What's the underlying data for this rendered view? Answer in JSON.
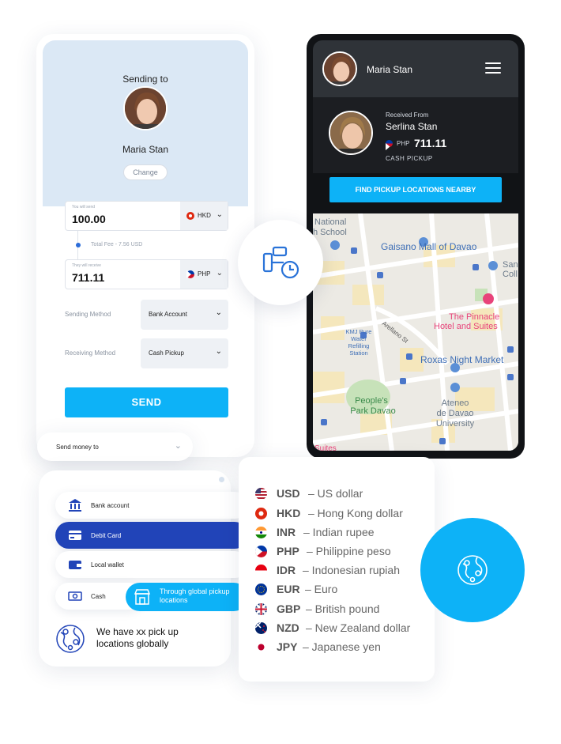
{
  "send_card": {
    "sending_to_label": "Sending to",
    "recipient_name": "Maria Stan",
    "change_label": "Change",
    "you_send_label": "You will send",
    "you_send_value": "100.00",
    "send_currency": "HKD",
    "fee_text": "Total Fee - 7.56 USD",
    "they_receive_label": "They will receive",
    "they_receive_value": "711.11",
    "receive_currency": "PHP",
    "sending_method_label": "Sending Method",
    "sending_method_value": "Bank Account",
    "receiving_method_label": "Receiving Method",
    "receiving_method_value": "Cash Pickup",
    "send_button": "SEND"
  },
  "send_money_dropdown": {
    "label": "Send money to"
  },
  "phone": {
    "header_name": "Maria Stan",
    "received_from_label": "Received From",
    "sender_name": "Serlina Stan",
    "currency": "PHP",
    "amount": "711.11",
    "method": "CASH  PICKUP",
    "find_button": "FIND PICKUP LOCATIONS NEARBY",
    "map_labels": {
      "school": "National\nh School",
      "mall": "Gaisano Mall of Davao",
      "college": "San\nColl",
      "street": "Arellano St",
      "hotel_1": "The Pinnacle",
      "hotel_2": "Hotel and Suites",
      "water_1": "KMJ Pure",
      "water_2": "Water",
      "water_3": "Refilling",
      "water_4": "Station",
      "market": "Roxas Night Market",
      "park_1": "People's",
      "park_2": "Park Davao",
      "uni_1": "Ateneo",
      "uni_2": "de Davao",
      "uni_3": "University",
      "bottom": "Suites"
    }
  },
  "methods": {
    "items": [
      {
        "label": "Bank account",
        "icon": "bank-icon"
      },
      {
        "label": "Debit Card",
        "icon": "card-icon"
      },
      {
        "label": "Local wallet",
        "icon": "wallet-icon"
      },
      {
        "label": "Cash",
        "icon": "cash-icon"
      }
    ],
    "global_pickup": "Through global pickup locations",
    "pickup_note": "We have xx pick up locations globally"
  },
  "currencies": [
    {
      "code": "USD",
      "name": "– US dollar"
    },
    {
      "code": "HKD",
      "name": "– Hong Kong dollar"
    },
    {
      "code": "INR",
      "name": "– Indian rupee"
    },
    {
      "code": "PHP",
      "name": "– Philippine peso"
    },
    {
      "code": "IDR",
      "name": "– Indonesian rupiah"
    },
    {
      "code": "EUR",
      "name": "– Euro"
    },
    {
      "code": "GBP",
      "name": "– British pound"
    },
    {
      "code": "NZD",
      "name": "– New Zealand dollar"
    },
    {
      "code": "JPY",
      "name": "– Japanese yen"
    }
  ],
  "colors": {
    "accent": "#0db2f7",
    "primary_dark": "#2144b8",
    "header_bg": "#dbe8f5"
  }
}
